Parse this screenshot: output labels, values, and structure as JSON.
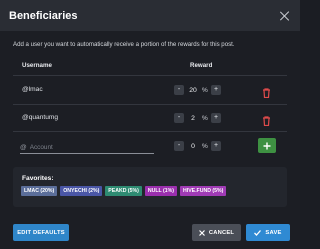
{
  "dialog": {
    "title": "Beneficiaries",
    "description": "Add a user you want to automatically receive a portion of the rewards for this post."
  },
  "columns": {
    "username": "Username",
    "reward": "Reward"
  },
  "rows": [
    {
      "user": "@lmac",
      "value": "20",
      "unit": "%"
    },
    {
      "user": "@quantumg",
      "value": "2",
      "unit": "%"
    }
  ],
  "new_row": {
    "at": "@",
    "placeholder": "Account",
    "value": "0",
    "unit": "%"
  },
  "stepper": {
    "minus": "-",
    "plus": "+"
  },
  "favorites": {
    "title": "Favorites:",
    "chips": [
      {
        "label": "LMAC (20%)",
        "color": "#5b6e9a"
      },
      {
        "label": "ONYECHI (2%)",
        "color": "#4a56a6"
      },
      {
        "label": "PEAKD (5%)",
        "color": "#2e8b72"
      },
      {
        "label": "NULL (1%)",
        "color": "#9b2fae"
      },
      {
        "label": "HIVE.FUND (5%)",
        "color": "#a03bb5"
      }
    ]
  },
  "footer": {
    "edit_defaults": "EDIT DEFAULTS",
    "cancel": "CANCEL",
    "save": "SAVE"
  },
  "colors": {
    "delete": "#e04b4b",
    "add": "#3e9142",
    "primary": "#2f8ad3"
  },
  "icons": {
    "close": "close-icon",
    "delete": "trash-icon",
    "add": "plus-icon",
    "cancel": "x-icon",
    "save": "check-icon"
  }
}
